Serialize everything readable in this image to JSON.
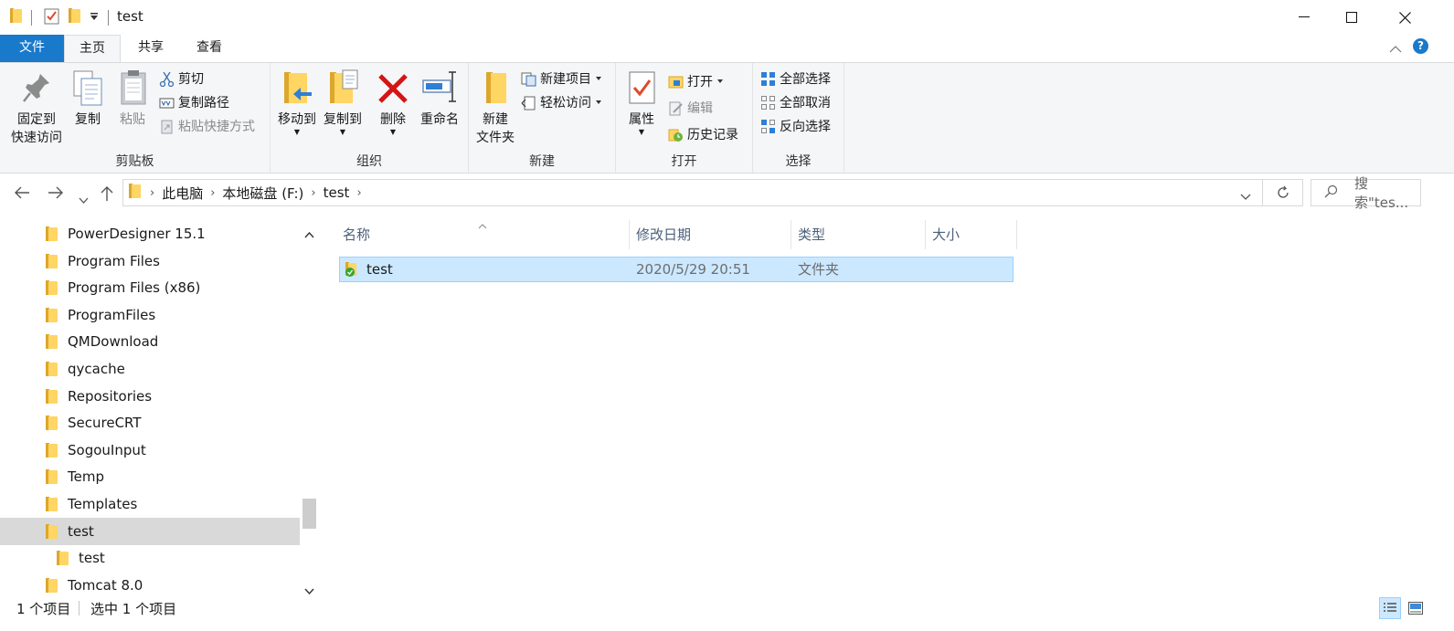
{
  "window": {
    "title": "test",
    "controls": {
      "minimize": "—",
      "maximize": "☐",
      "close": "✕"
    }
  },
  "tabs": {
    "file": "文件",
    "home": "主页",
    "share": "共享",
    "view": "查看"
  },
  "ribbon": {
    "clipboard": {
      "label": "剪贴板",
      "pin_line1": "固定到",
      "pin_line2": "快速访问",
      "copy": "复制",
      "paste": "粘贴",
      "cut": "剪切",
      "copy_path": "复制路径",
      "paste_shortcut": "粘贴快捷方式"
    },
    "organize": {
      "label": "组织",
      "move_to": "移动到",
      "copy_to": "复制到",
      "delete": "删除",
      "rename": "重命名"
    },
    "new": {
      "label": "新建",
      "new_folder_line1": "新建",
      "new_folder_line2": "文件夹",
      "new_item": "新建项目",
      "easy_access": "轻松访问"
    },
    "open": {
      "label": "打开",
      "properties": "属性",
      "open": "打开",
      "edit": "编辑",
      "history": "历史记录"
    },
    "select": {
      "label": "选择",
      "select_all": "全部选择",
      "select_none": "全部取消",
      "invert": "反向选择"
    }
  },
  "address": {
    "breadcrumbs": [
      "此电脑",
      "本地磁盘 (F:)",
      "test"
    ],
    "search_placeholder": "搜索\"tes..."
  },
  "nav_pane": {
    "items": [
      {
        "label": "PowerDesigner 15.1"
      },
      {
        "label": "Program Files"
      },
      {
        "label": "Program Files (x86)"
      },
      {
        "label": "ProgramFiles"
      },
      {
        "label": "QMDownload"
      },
      {
        "label": "qycache"
      },
      {
        "label": "Repositories"
      },
      {
        "label": "SecureCRT"
      },
      {
        "label": "SogouInput"
      },
      {
        "label": "Temp"
      },
      {
        "label": "Templates"
      },
      {
        "label": "test",
        "selected": true
      },
      {
        "label": "test",
        "child": true
      },
      {
        "label": "Tomcat  8.0"
      }
    ]
  },
  "file_list": {
    "columns": {
      "name": "名称",
      "modified": "修改日期",
      "type": "类型",
      "size": "大小"
    },
    "rows": [
      {
        "name": "test",
        "modified": "2020/5/29 20:51",
        "type": "文件夹",
        "size": ""
      }
    ]
  },
  "status": {
    "count": "1 个项目",
    "selected": "选中 1 个项目"
  },
  "colors": {
    "file_tab": "#1979ca",
    "selection": "#cce8ff",
    "selection_border": "#99d1ff",
    "folder": "#ffd563"
  }
}
